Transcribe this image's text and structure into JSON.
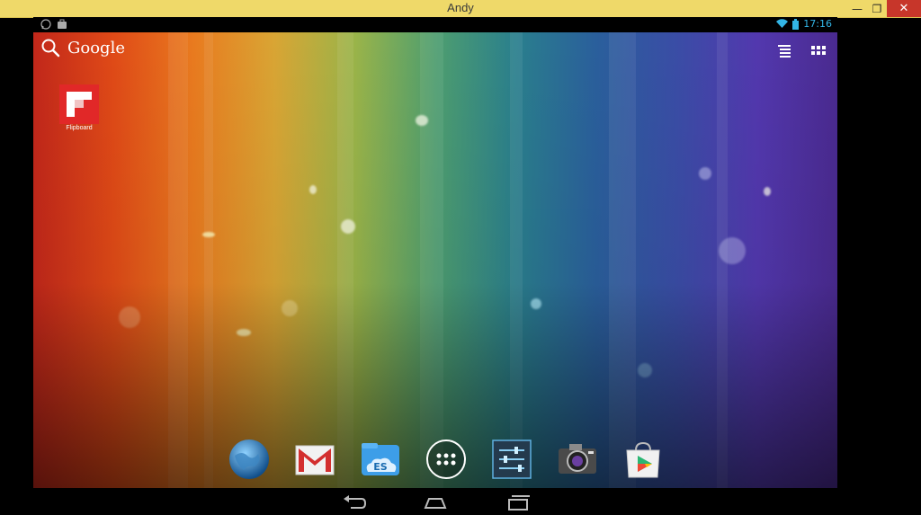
{
  "window": {
    "title": "Andy",
    "minimize_glyph": "—",
    "maximize_glyph": "❐",
    "close_glyph": "✕"
  },
  "statusbar": {
    "left_icons": [
      "whatsapp-icon",
      "briefcase-icon"
    ],
    "time": "17:16",
    "right_icons": [
      "wifi-icon",
      "battery-icon"
    ]
  },
  "home": {
    "search_label": "Google",
    "top_icons": [
      "voice-list-icon",
      "app-drawer-icon"
    ],
    "shortcuts": [
      {
        "label": "Flipboard",
        "icon": "flipboard-icon"
      }
    ],
    "dock": [
      {
        "name": "browser-icon"
      },
      {
        "name": "gmail-icon"
      },
      {
        "name": "es-file-explorer-icon"
      },
      {
        "name": "all-apps-icon"
      },
      {
        "name": "settings-icon"
      },
      {
        "name": "camera-icon"
      },
      {
        "name": "play-store-icon"
      }
    ]
  },
  "navbar": [
    "back-icon",
    "home-icon",
    "recent-apps-icon"
  ],
  "colors": {
    "titlebar": "#efd969",
    "close": "#c7362a",
    "status_accent": "#33b5e5",
    "flipboard_red": "#e12828"
  }
}
